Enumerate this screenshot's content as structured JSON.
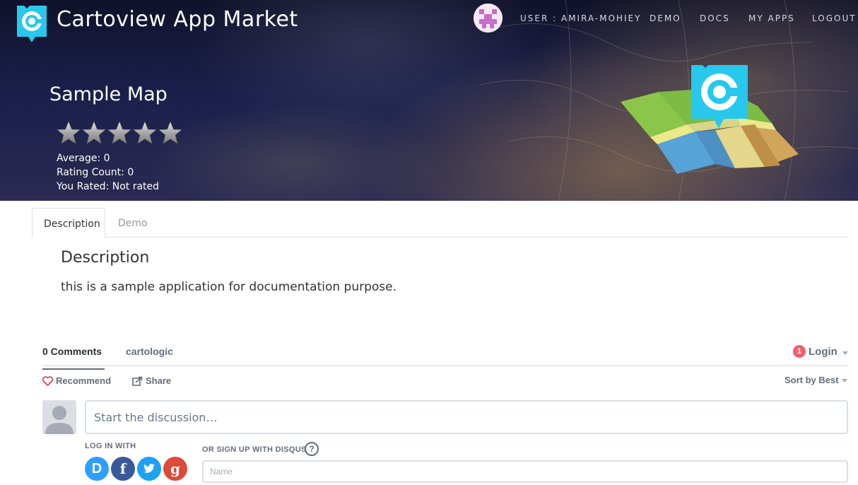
{
  "header": {
    "brand_title": "Cartoview App Market",
    "nav": [
      {
        "label": "USER : AMIRA-MOHIEY"
      },
      {
        "label": "DEMO"
      },
      {
        "label": "DOCS"
      },
      {
        "label": "MY APPS"
      },
      {
        "label": "LOGOUT"
      }
    ]
  },
  "app": {
    "title": "Sample Map",
    "stars_total": 5,
    "rating": {
      "average": "Average: 0",
      "count": "Rating Count: 0",
      "you_rated": "You Rated: Not rated"
    }
  },
  "tabs": [
    {
      "label": "Description",
      "active": true
    },
    {
      "label": "Demo",
      "active": false
    }
  ],
  "description": {
    "heading": "Description",
    "text": "this is a sample application for documentation purpose."
  },
  "comments": {
    "count_label": "0 Comments",
    "community": "cartologic",
    "notification_count": "1",
    "login_label": "Login",
    "recommend_label": "Recommend",
    "share_label": "Share",
    "sort_label": "Sort by Best",
    "input_placeholder": "Start the discussion…",
    "login_with": "LOG IN WITH",
    "signup_with": "OR SIGN UP WITH DISQUS",
    "help_glyph": "?",
    "name_placeholder": "Name",
    "social": [
      {
        "name": "disqus",
        "glyph": "D",
        "color": "#2e9fff"
      },
      {
        "name": "facebook",
        "glyph": "f",
        "color": "#3b5998"
      },
      {
        "name": "twitter",
        "glyph": "",
        "color": "#1da1f2"
      },
      {
        "name": "google",
        "glyph": "g",
        "color": "#dd4b39"
      }
    ]
  },
  "colors": {
    "brand_accent": "#27c8ec",
    "hero_dark": "#1a1f4a",
    "badge": "#f05f70"
  }
}
